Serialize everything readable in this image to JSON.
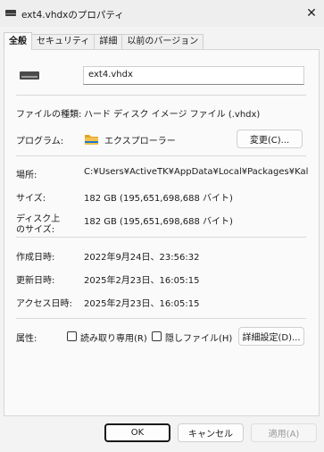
{
  "window": {
    "title": "ext4.vhdxのプロパティ",
    "close": "✕"
  },
  "tabs": [
    "全般",
    "セキュリティ",
    "詳細",
    "以前のバージョン"
  ],
  "general": {
    "file_name": "ext4.vhdx",
    "file_type_label": "ファイルの種類:",
    "file_type_value": "ハード ディスク イメージ ファイル (.vhdx)",
    "program_label": "プログラム:",
    "program_value": "エクスプローラー",
    "change_button": "変更(C)...",
    "location_label": "場所:",
    "location_value": "C:¥Users¥ActiveTK¥AppData¥Local¥Packages¥KaliLinux",
    "size_label": "サイズ:",
    "size_value": "182 GB (195,651,698,688 バイト)",
    "size_on_disk_label_1": "ディスク上",
    "size_on_disk_label_2": "のサイズ:",
    "size_on_disk_value": "182 GB (195,651,698,688 バイト)",
    "created_label": "作成日時:",
    "created_value": "2022年9月24日、23:56:32",
    "modified_label": "更新日時:",
    "modified_value": "2025年2月23日、16:05:15",
    "accessed_label": "アクセス日時:",
    "accessed_value": "2025年2月23日、16:05:15",
    "attributes_label": "属性:",
    "readonly_label": "読み取り専用(R)",
    "hidden_label": "隠しファイル(H)",
    "advanced_button": "詳細設定(D)..."
  },
  "buttons": {
    "ok": "OK",
    "cancel": "キャンセル",
    "apply": "適用(A)"
  },
  "colors": {
    "folder": "#f2c14e",
    "folder_dark": "#e0a526",
    "primary_border": "#1a1a1a"
  }
}
